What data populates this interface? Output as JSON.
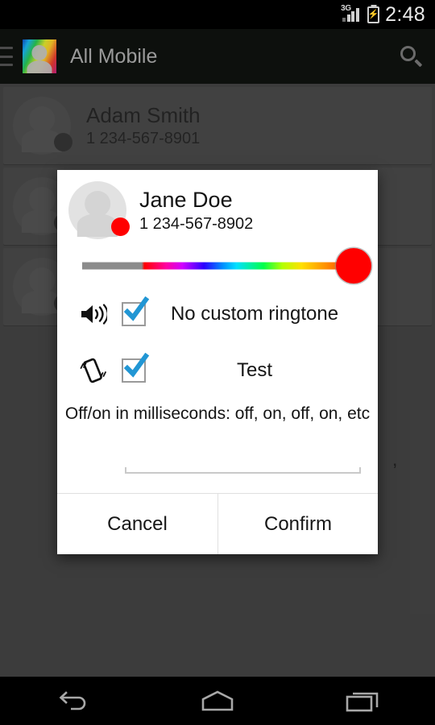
{
  "status_bar": {
    "network_label": "3G",
    "battery_glyph": "⚡",
    "time": "2:48",
    "icons": [
      "signal-icon",
      "battery-charging-icon"
    ]
  },
  "app_bar": {
    "menu_icon": "hamburger-menu-icon",
    "app_icon": "contacts-app-icon",
    "title": "All Mobile",
    "search_icon": "search-icon"
  },
  "contact_list": {
    "rows": [
      {
        "name": "Adam Smith",
        "phone": "1 234-567-8901"
      },
      {
        "name": "",
        "phone": ""
      },
      {
        "name": "",
        "phone": ""
      }
    ]
  },
  "dialog": {
    "contact": {
      "name": "Jane Doe",
      "phone": "1 234-567-8902",
      "badge_color": "#ff0000"
    },
    "color_slider": {
      "name": "color-slider",
      "thumb_color": "#ff0000",
      "thumb_position_percent": 100,
      "inactive_color": "#8c8c8c"
    },
    "options": [
      {
        "icon": "speaker-sound-icon",
        "label": "No custom ringtone",
        "checked": true
      },
      {
        "icon": "vibration-icon",
        "label": "Test",
        "checked": true
      }
    ],
    "checkbox_color": "#2196d4",
    "vibration_hint": "Off/on in milliseconds: off, on, off, on, etc",
    "vibration_input": {
      "value": "",
      "placeholder": ""
    },
    "stray_text": ",",
    "buttons": {
      "cancel": "Cancel",
      "confirm": "Confirm"
    }
  },
  "nav_bar": {
    "back_icon": "back-arrow-icon",
    "home_icon": "home-icon",
    "recents_icon": "recent-apps-icon"
  }
}
